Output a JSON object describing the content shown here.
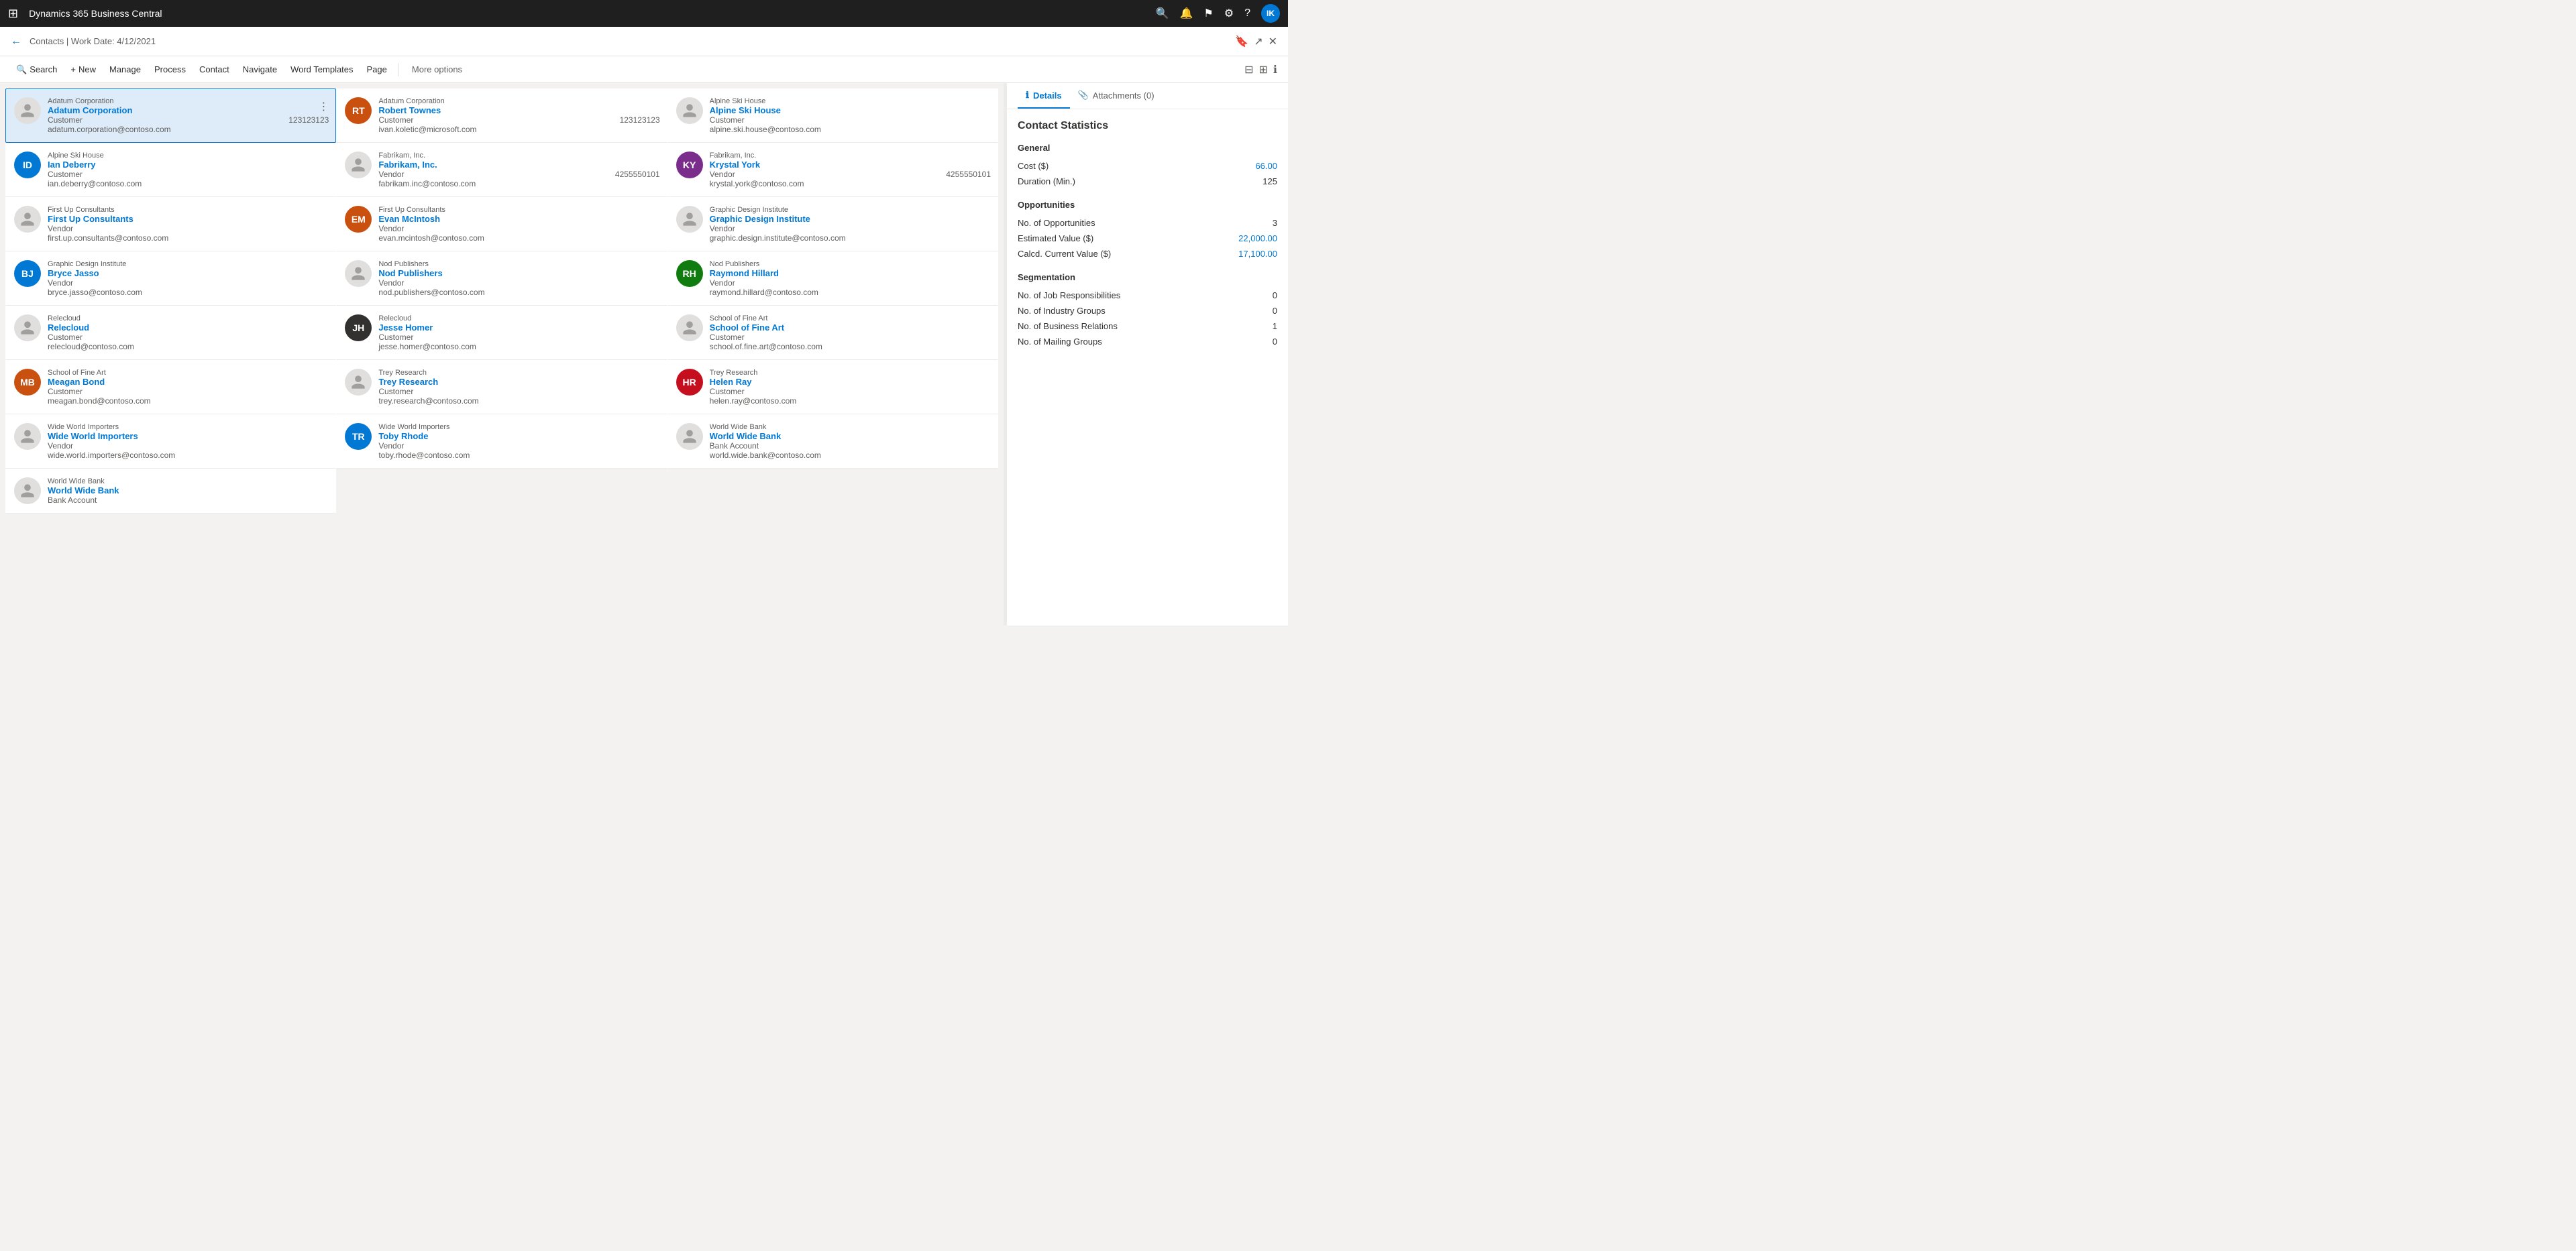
{
  "topbar": {
    "app_title": "Dynamics 365 Business Central",
    "icons": [
      "search",
      "bell",
      "flag",
      "settings",
      "help"
    ],
    "avatar_initials": "IK"
  },
  "subheader": {
    "breadcrumb": "Contacts | Work Date: 4/12/2021",
    "icons": [
      "bookmark",
      "external",
      "collapse"
    ]
  },
  "toolbar": {
    "buttons": [
      {
        "icon": "🔍",
        "label": "Search"
      },
      {
        "icon": "+",
        "label": "New"
      },
      {
        "icon": "",
        "label": "Manage"
      },
      {
        "icon": "",
        "label": "Process"
      },
      {
        "icon": "",
        "label": "Contact"
      },
      {
        "icon": "",
        "label": "Navigate"
      },
      {
        "icon": "",
        "label": "Word Templates"
      },
      {
        "icon": "",
        "label": "Page"
      }
    ],
    "more_label": "More options",
    "right_icons": [
      "filter",
      "grid",
      "info"
    ]
  },
  "contacts": [
    {
      "company": "Adatum Corporation",
      "name": "Adatum Corporation",
      "type": "Customer",
      "phone": "123123123",
      "email": "adatum.corporation@contoso.com",
      "avatar_type": "icon",
      "selected": true
    },
    {
      "company": "Adatum Corporation",
      "name": "Robert Townes",
      "type": "Customer",
      "phone": "123123123",
      "email": "ivan.koletic@microsoft.com",
      "avatar_type": "photo",
      "avatar_color": "#ca5010"
    },
    {
      "company": "Alpine Ski House",
      "name": "Alpine Ski House",
      "type": "Customer",
      "phone": "",
      "email": "alpine.ski.house@contoso.com",
      "avatar_type": "icon"
    },
    {
      "company": "Alpine Ski House",
      "name": "Ian Deberry",
      "type": "Customer",
      "phone": "",
      "email": "ian.deberry@contoso.com",
      "avatar_type": "photo",
      "avatar_color": "#0078d4"
    },
    {
      "company": "Fabrikam, Inc.",
      "name": "Fabrikam, Inc.",
      "type": "Vendor",
      "phone": "4255550101",
      "email": "fabrikam.inc@contoso.com",
      "avatar_type": "icon"
    },
    {
      "company": "Fabrikam, Inc.",
      "name": "Krystal York",
      "type": "Vendor",
      "phone": "4255550101",
      "email": "krystal.york@contoso.com",
      "avatar_type": "photo",
      "avatar_color": "#7b2d8b"
    },
    {
      "company": "First Up Consultants",
      "name": "First Up Consultants",
      "type": "Vendor",
      "phone": "",
      "email": "first.up.consultants@contoso.com",
      "avatar_type": "icon"
    },
    {
      "company": "First Up Consultants",
      "name": "Evan McIntosh",
      "type": "Vendor",
      "phone": "",
      "email": "evan.mcintosh@contoso.com",
      "avatar_type": "photo",
      "avatar_color": "#ca5010"
    },
    {
      "company": "Graphic Design Institute",
      "name": "Graphic Design Institute",
      "type": "Vendor",
      "phone": "",
      "email": "graphic.design.institute@contoso.com",
      "avatar_type": "icon"
    },
    {
      "company": "Graphic Design Institute",
      "name": "Bryce Jasso",
      "type": "Vendor",
      "phone": "",
      "email": "bryce.jasso@contoso.com",
      "avatar_type": "photo",
      "avatar_color": "#0078d4"
    },
    {
      "company": "Nod Publishers",
      "name": "Nod Publishers",
      "type": "Vendor",
      "phone": "",
      "email": "nod.publishers@contoso.com",
      "avatar_type": "icon"
    },
    {
      "company": "Nod Publishers",
      "name": "Raymond Hillard",
      "type": "Vendor",
      "phone": "",
      "email": "raymond.hillard@contoso.com",
      "avatar_type": "photo",
      "avatar_color": "#107c10"
    },
    {
      "company": "Relecloud",
      "name": "Relecloud",
      "type": "Customer",
      "phone": "",
      "email": "relecloud@contoso.com",
      "avatar_type": "icon"
    },
    {
      "company": "Relecloud",
      "name": "Jesse Homer",
      "type": "Customer",
      "phone": "",
      "email": "jesse.homer@contoso.com",
      "avatar_type": "photo",
      "avatar_color": "#323130"
    },
    {
      "company": "School of Fine Art",
      "name": "School of Fine Art",
      "type": "Customer",
      "phone": "",
      "email": "school.of.fine.art@contoso.com",
      "avatar_type": "icon"
    },
    {
      "company": "School of Fine Art",
      "name": "Meagan Bond",
      "type": "Customer",
      "phone": "",
      "email": "meagan.bond@contoso.com",
      "avatar_type": "photo",
      "avatar_color": "#ca5010"
    },
    {
      "company": "Trey Research",
      "name": "Trey Research",
      "type": "Customer",
      "phone": "",
      "email": "trey.research@contoso.com",
      "avatar_type": "icon"
    },
    {
      "company": "Trey Research",
      "name": "Helen Ray",
      "type": "Customer",
      "phone": "",
      "email": "helen.ray@contoso.com",
      "avatar_type": "photo",
      "avatar_color": "#c50f1f"
    },
    {
      "company": "Wide World Importers",
      "name": "Wide World Importers",
      "type": "Vendor",
      "phone": "",
      "email": "wide.world.importers@contoso.com",
      "avatar_type": "icon"
    },
    {
      "company": "Wide World Importers",
      "name": "Toby Rhode",
      "type": "Vendor",
      "phone": "",
      "email": "toby.rhode@contoso.com",
      "avatar_type": "photo",
      "avatar_color": "#0078d4"
    },
    {
      "company": "World Wide Bank",
      "name": "World Wide Bank",
      "type": "Bank Account",
      "phone": "",
      "email": "world.wide.bank@contoso.com",
      "avatar_type": "icon"
    },
    {
      "company": "World Wide Bank",
      "name": "World Wide Bank",
      "type": "Bank Account",
      "phone": "",
      "email": "",
      "avatar_type": "icon",
      "partial": true
    }
  ],
  "details": {
    "tabs": [
      {
        "label": "Details",
        "icon": "ℹ",
        "active": true
      },
      {
        "label": "Attachments (0)",
        "icon": "📎",
        "active": false
      }
    ],
    "title": "Contact Statistics",
    "sections": [
      {
        "title": "General",
        "rows": [
          {
            "label": "Cost ($)",
            "value": "66.00",
            "is_link": true
          },
          {
            "label": "Duration (Min.)",
            "value": "125",
            "is_link": false
          }
        ]
      },
      {
        "title": "Opportunities",
        "rows": [
          {
            "label": "No. of Opportunities",
            "value": "3",
            "is_link": false
          },
          {
            "label": "Estimated Value ($)",
            "value": "22,000.00",
            "is_link": true
          },
          {
            "label": "Calcd. Current Value ($)",
            "value": "17,100.00",
            "is_link": true
          }
        ]
      },
      {
        "title": "Segmentation",
        "rows": [
          {
            "label": "No. of Job Responsibilities",
            "value": "0",
            "is_link": false
          },
          {
            "label": "No. of Industry Groups",
            "value": "0",
            "is_link": false
          },
          {
            "label": "No. of Business Relations",
            "value": "1",
            "is_link": false
          },
          {
            "label": "No. of Mailing Groups",
            "value": "0",
            "is_link": false
          }
        ]
      }
    ]
  }
}
